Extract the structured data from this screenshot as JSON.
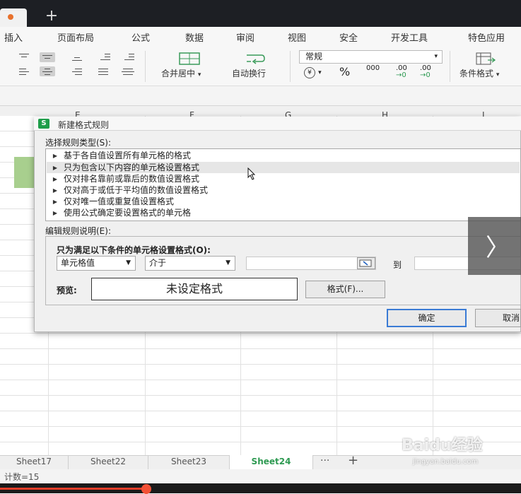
{
  "titlebar": {
    "new_tab_symbol": "+"
  },
  "menu": [
    "插入",
    "页面布局",
    "公式",
    "数据",
    "审阅",
    "视图",
    "安全",
    "开发工具",
    "特色应用"
  ],
  "toolbar": {
    "merge_label": "合并居中",
    "wrap_label": "自动换行",
    "number_format": "常规",
    "percent": "%",
    "thousands": "000",
    "dec_increase": ".00",
    "dec_decrease": ".00",
    "cond_format_label": "条件格式",
    "dropdown_caret": "▾"
  },
  "columns": [
    "E",
    "F",
    "G",
    "H",
    "I"
  ],
  "dialog": {
    "app_icon": "S",
    "title": "新建格式规则",
    "select_type_label": "选择规则类型(S):",
    "rule_types": [
      "基于各自值设置所有单元格的格式",
      "只为包含以下内容的单元格设置格式",
      "仅对排名靠前或靠后的数值设置格式",
      "仅对高于或低于平均值的数值设置格式",
      "仅对唯一值或重复值设置格式",
      "使用公式确定要设置格式的单元格"
    ],
    "selected_rule_index": 1,
    "edit_desc_label": "编辑规则说明(E):",
    "condition_heading": "只为满足以下条件的单元格设置格式(O):",
    "condition_field": "单元格值",
    "condition_operator": "介于",
    "to_label": "到",
    "preview_label": "预览:",
    "preview_text": "未设定格式",
    "format_button": "格式(F)...",
    "ok_button": "确定",
    "cancel_button": "取消"
  },
  "sheets": [
    "Sheet17",
    "Sheet22",
    "Sheet23",
    "Sheet24"
  ],
  "active_sheet": "Sheet24",
  "sheet_more": "···",
  "sheet_add": "+",
  "status": {
    "count": "计数=15"
  },
  "overlay": {
    "next_symbol": "〉"
  },
  "watermark": {
    "logo": "Baidu经验",
    "site": "jingyan.baidu.com"
  },
  "colors": {
    "accent_green": "#2e9a52",
    "cell_green": "#a8cf8e",
    "focus_blue": "#3a7bd5",
    "progress_red": "#e23d28"
  }
}
